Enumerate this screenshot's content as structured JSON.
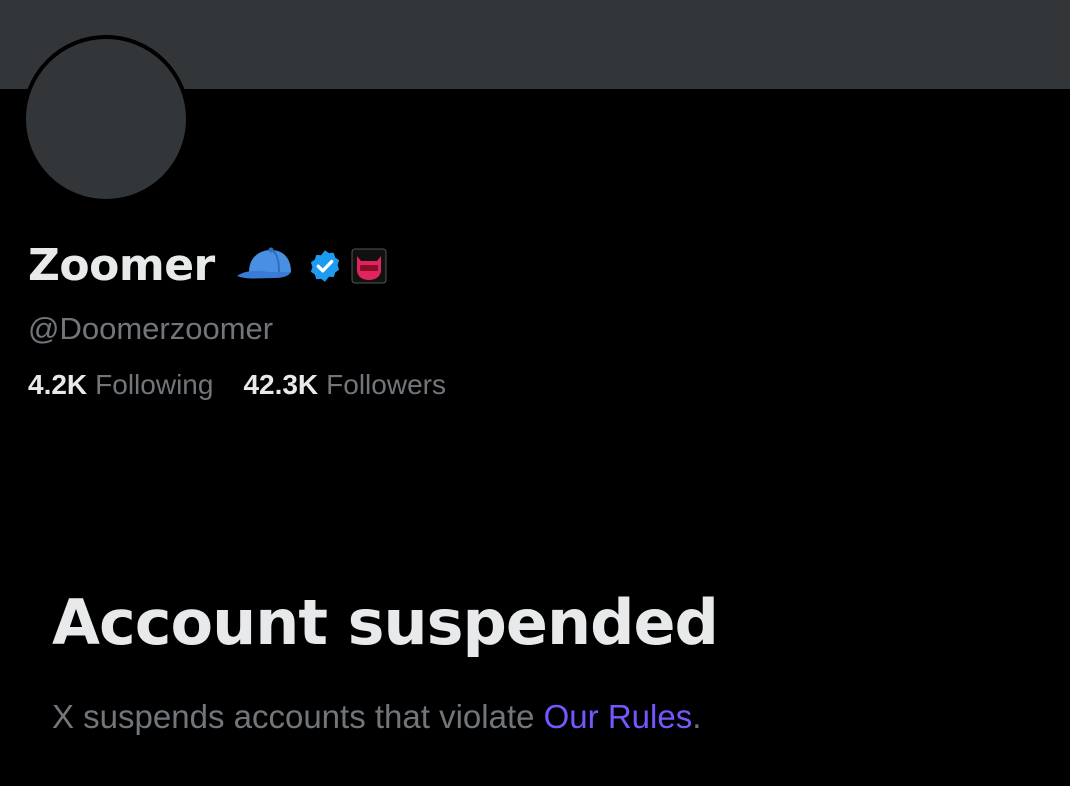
{
  "profile": {
    "display_name": "Zoomer",
    "handle": "@Doomerzoomer",
    "badges": [
      {
        "icon": "blue-cap-icon",
        "color": "#4a90e2"
      },
      {
        "icon": "verified-badge-icon",
        "color": "#1d9bf0"
      },
      {
        "icon": "affiliate-badge-icon",
        "color": "#e0245e"
      }
    ],
    "stats": {
      "following_count": "4.2K",
      "following_label": "Following",
      "followers_count": "42.3K",
      "followers_label": "Followers"
    }
  },
  "suspension": {
    "title": "Account suspended",
    "message": "X suspends accounts that violate",
    "link_label": "Our Rules",
    "trailing": "."
  },
  "colors": {
    "background": "#000000",
    "banner": "#333639",
    "primary_text": "#e7e9ea",
    "secondary_text": "#71767b",
    "link": "#7856ff"
  }
}
